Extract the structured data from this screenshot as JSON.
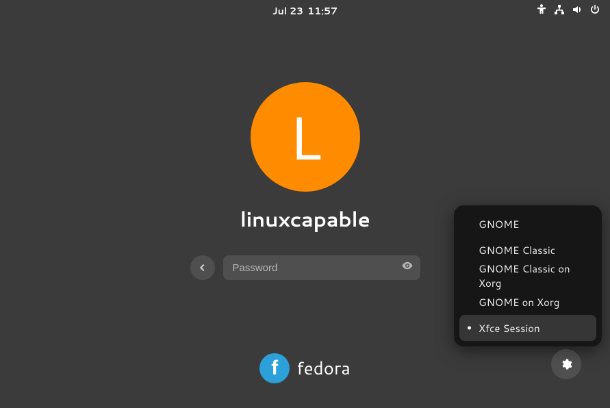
{
  "topbar": {
    "date": "Jul 23",
    "time": "11:57"
  },
  "user": {
    "initial": "L",
    "name": "linuxcapable",
    "avatar_color": "#ff8c00"
  },
  "password": {
    "placeholder": "Password"
  },
  "branding": {
    "distro": "fedora",
    "logo_glyph": "f"
  },
  "sessions": {
    "items": [
      {
        "label": "GNOME",
        "selected": false
      },
      {
        "label": "GNOME Classic",
        "selected": false
      },
      {
        "label": "GNOME Classic on Xorg",
        "selected": false
      },
      {
        "label": "GNOME on Xorg",
        "selected": false
      },
      {
        "label": "Xfce Session",
        "selected": true
      }
    ]
  }
}
